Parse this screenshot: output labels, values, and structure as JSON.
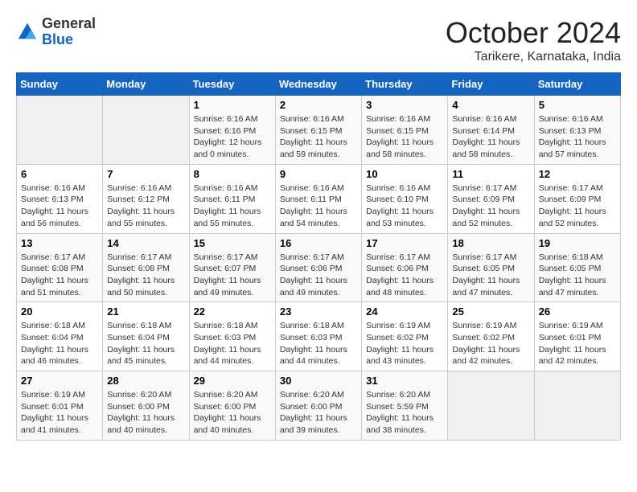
{
  "header": {
    "logo": {
      "general": "General",
      "blue": "Blue"
    },
    "title": "October 2024",
    "location": "Tarikere, Karnataka, India"
  },
  "calendar": {
    "weekdays": [
      "Sunday",
      "Monday",
      "Tuesday",
      "Wednesday",
      "Thursday",
      "Friday",
      "Saturday"
    ],
    "weeks": [
      [
        {
          "day": "",
          "info": ""
        },
        {
          "day": "",
          "info": ""
        },
        {
          "day": "1",
          "info": "Sunrise: 6:16 AM\nSunset: 6:16 PM\nDaylight: 12 hours\nand 0 minutes."
        },
        {
          "day": "2",
          "info": "Sunrise: 6:16 AM\nSunset: 6:15 PM\nDaylight: 11 hours\nand 59 minutes."
        },
        {
          "day": "3",
          "info": "Sunrise: 6:16 AM\nSunset: 6:15 PM\nDaylight: 11 hours\nand 58 minutes."
        },
        {
          "day": "4",
          "info": "Sunrise: 6:16 AM\nSunset: 6:14 PM\nDaylight: 11 hours\nand 58 minutes."
        },
        {
          "day": "5",
          "info": "Sunrise: 6:16 AM\nSunset: 6:13 PM\nDaylight: 11 hours\nand 57 minutes."
        }
      ],
      [
        {
          "day": "6",
          "info": "Sunrise: 6:16 AM\nSunset: 6:13 PM\nDaylight: 11 hours\nand 56 minutes."
        },
        {
          "day": "7",
          "info": "Sunrise: 6:16 AM\nSunset: 6:12 PM\nDaylight: 11 hours\nand 55 minutes."
        },
        {
          "day": "8",
          "info": "Sunrise: 6:16 AM\nSunset: 6:11 PM\nDaylight: 11 hours\nand 55 minutes."
        },
        {
          "day": "9",
          "info": "Sunrise: 6:16 AM\nSunset: 6:11 PM\nDaylight: 11 hours\nand 54 minutes."
        },
        {
          "day": "10",
          "info": "Sunrise: 6:16 AM\nSunset: 6:10 PM\nDaylight: 11 hours\nand 53 minutes."
        },
        {
          "day": "11",
          "info": "Sunrise: 6:17 AM\nSunset: 6:09 PM\nDaylight: 11 hours\nand 52 minutes."
        },
        {
          "day": "12",
          "info": "Sunrise: 6:17 AM\nSunset: 6:09 PM\nDaylight: 11 hours\nand 52 minutes."
        }
      ],
      [
        {
          "day": "13",
          "info": "Sunrise: 6:17 AM\nSunset: 6:08 PM\nDaylight: 11 hours\nand 51 minutes."
        },
        {
          "day": "14",
          "info": "Sunrise: 6:17 AM\nSunset: 6:08 PM\nDaylight: 11 hours\nand 50 minutes."
        },
        {
          "day": "15",
          "info": "Sunrise: 6:17 AM\nSunset: 6:07 PM\nDaylight: 11 hours\nand 49 minutes."
        },
        {
          "day": "16",
          "info": "Sunrise: 6:17 AM\nSunset: 6:06 PM\nDaylight: 11 hours\nand 49 minutes."
        },
        {
          "day": "17",
          "info": "Sunrise: 6:17 AM\nSunset: 6:06 PM\nDaylight: 11 hours\nand 48 minutes."
        },
        {
          "day": "18",
          "info": "Sunrise: 6:17 AM\nSunset: 6:05 PM\nDaylight: 11 hours\nand 47 minutes."
        },
        {
          "day": "19",
          "info": "Sunrise: 6:18 AM\nSunset: 6:05 PM\nDaylight: 11 hours\nand 47 minutes."
        }
      ],
      [
        {
          "day": "20",
          "info": "Sunrise: 6:18 AM\nSunset: 6:04 PM\nDaylight: 11 hours\nand 46 minutes."
        },
        {
          "day": "21",
          "info": "Sunrise: 6:18 AM\nSunset: 6:04 PM\nDaylight: 11 hours\nand 45 minutes."
        },
        {
          "day": "22",
          "info": "Sunrise: 6:18 AM\nSunset: 6:03 PM\nDaylight: 11 hours\nand 44 minutes."
        },
        {
          "day": "23",
          "info": "Sunrise: 6:18 AM\nSunset: 6:03 PM\nDaylight: 11 hours\nand 44 minutes."
        },
        {
          "day": "24",
          "info": "Sunrise: 6:19 AM\nSunset: 6:02 PM\nDaylight: 11 hours\nand 43 minutes."
        },
        {
          "day": "25",
          "info": "Sunrise: 6:19 AM\nSunset: 6:02 PM\nDaylight: 11 hours\nand 42 minutes."
        },
        {
          "day": "26",
          "info": "Sunrise: 6:19 AM\nSunset: 6:01 PM\nDaylight: 11 hours\nand 42 minutes."
        }
      ],
      [
        {
          "day": "27",
          "info": "Sunrise: 6:19 AM\nSunset: 6:01 PM\nDaylight: 11 hours\nand 41 minutes."
        },
        {
          "day": "28",
          "info": "Sunrise: 6:20 AM\nSunset: 6:00 PM\nDaylight: 11 hours\nand 40 minutes."
        },
        {
          "day": "29",
          "info": "Sunrise: 6:20 AM\nSunset: 6:00 PM\nDaylight: 11 hours\nand 40 minutes."
        },
        {
          "day": "30",
          "info": "Sunrise: 6:20 AM\nSunset: 6:00 PM\nDaylight: 11 hours\nand 39 minutes."
        },
        {
          "day": "31",
          "info": "Sunrise: 6:20 AM\nSunset: 5:59 PM\nDaylight: 11 hours\nand 38 minutes."
        },
        {
          "day": "",
          "info": ""
        },
        {
          "day": "",
          "info": ""
        }
      ]
    ]
  }
}
